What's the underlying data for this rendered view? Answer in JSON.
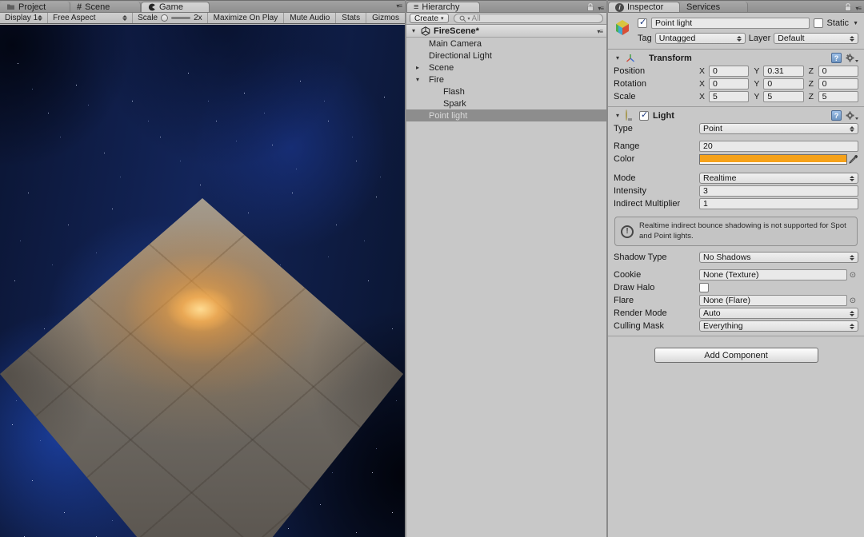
{
  "icons": {
    "pane_menu": "▾≡",
    "fold_open": "▾",
    "fold_closed": "▸",
    "hierarchy_list": "≡",
    "scene_hash": "#",
    "picker": "⊙",
    "static_caret": "▼",
    "check": "✓",
    "info": "i",
    "help": "?",
    "warning": "!",
    "create_caret": "▾"
  },
  "game": {
    "tabs": {
      "project": "Project",
      "scene": "Scene",
      "game": "Game"
    },
    "toolbar": {
      "display": "Display 1",
      "aspect": "Free Aspect",
      "scale_label": "Scale",
      "scale_value": "2x",
      "maximize": "Maximize On Play",
      "mute": "Mute Audio",
      "stats": "Stats",
      "gizmos": "Gizmos"
    }
  },
  "hierarchy": {
    "tab": "Hierarchy",
    "create": "Create",
    "search_placeholder": "All",
    "root": "FireScene*",
    "items": [
      {
        "label": "Main Camera"
      },
      {
        "label": "Directional Light"
      },
      {
        "label": "Scene"
      },
      {
        "label": "Fire"
      },
      {
        "label": "Flash"
      },
      {
        "label": "Spark"
      },
      {
        "label": "Point light"
      }
    ]
  },
  "inspector": {
    "tab": "Inspector",
    "tab2": "Services",
    "name": "Point light",
    "static_label": "Static",
    "tag_label": "Tag",
    "tag_value": "Untagged",
    "layer_label": "Layer",
    "layer_value": "Default",
    "transform": {
      "title": "Transform",
      "axis_x": "X",
      "axis_y": "Y",
      "axis_z": "Z",
      "rows": [
        {
          "label": "Position",
          "x": "0",
          "y": "0.31",
          "z": "0"
        },
        {
          "label": "Rotation",
          "x": "0",
          "y": "0",
          "z": "0"
        },
        {
          "label": "Scale",
          "x": "5",
          "y": "5",
          "z": "5"
        }
      ]
    },
    "light": {
      "title": "Light",
      "type_label": "Type",
      "type_value": "Point",
      "range_label": "Range",
      "range_value": "20",
      "color_label": "Color",
      "color_hex": "#F6A21A",
      "mode_label": "Mode",
      "mode_value": "Realtime",
      "intensity_label": "Intensity",
      "intensity_value": "3",
      "indirect_label": "Indirect Multiplier",
      "indirect_value": "1",
      "warning": "Realtime indirect bounce shadowing is not supported for Spot and Point lights.",
      "shadow_label": "Shadow Type",
      "shadow_value": "No Shadows",
      "cookie_label": "Cookie",
      "cookie_value": "None (Texture)",
      "halo_label": "Draw Halo",
      "flare_label": "Flare",
      "flare_value": "None (Flare)",
      "render_label": "Render Mode",
      "render_value": "Auto",
      "culling_label": "Culling Mask",
      "culling_value": "Everything"
    },
    "add_component": "Add Component"
  }
}
